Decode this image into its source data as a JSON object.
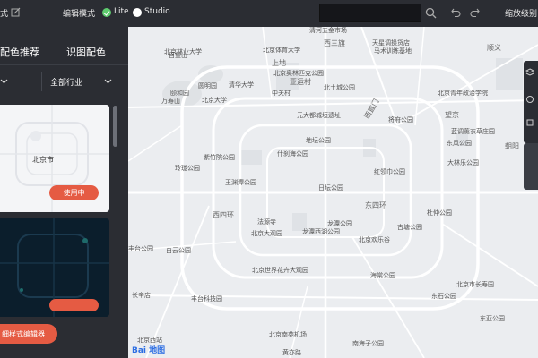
{
  "topbar": {
    "left_text": "式",
    "mode_label": "编辑模式",
    "lite_label": "Lite",
    "studio_label": "Studio",
    "zoom_label": "缩放级别"
  },
  "left_panel": {
    "tab_recommend": "配色推荐",
    "tab_recognize": "识图配色",
    "industry_select": "全部行业",
    "card_light": {
      "city_label": "北京市",
      "use_button": "使用中"
    },
    "editor_button": "细样式编辑器"
  },
  "map": {
    "labels": [
      {
        "text": "清河五金市场"
      },
      {
        "text": "天星调换货店"
      },
      {
        "text": "马术训练基地"
      },
      {
        "text": "西三旗"
      },
      {
        "text": "北京体育大学"
      },
      {
        "text": "北京林业大学"
      },
      {
        "text": "上地"
      },
      {
        "text": "百望山"
      },
      {
        "text": "颐和园"
      },
      {
        "text": "万寿山"
      },
      {
        "text": "清华大学"
      },
      {
        "text": "北京大学"
      },
      {
        "text": "圆明园"
      },
      {
        "text": "北京奥林匹克公园"
      },
      {
        "text": "北土城公园"
      },
      {
        "text": "北京青年政治学院"
      },
      {
        "text": "亚运村"
      },
      {
        "text": "中关村"
      },
      {
        "text": "元大都城垣遗址"
      },
      {
        "text": "将府公园"
      },
      {
        "text": "望京"
      },
      {
        "text": "西直门"
      },
      {
        "text": "地坛公园"
      },
      {
        "text": "蓝调薰衣草庄园"
      },
      {
        "text": "紫竹院公园"
      },
      {
        "text": "什刹海公园"
      },
      {
        "text": "东风公园"
      },
      {
        "text": "大林乐公园"
      },
      {
        "text": "红领巾公园"
      },
      {
        "text": "玲珑公园"
      },
      {
        "text": "玉渊潭公园"
      },
      {
        "text": "日坛公园"
      },
      {
        "text": "东四环"
      },
      {
        "text": "法源寺"
      },
      {
        "text": "龙潭公园"
      },
      {
        "text": "古塘公园"
      },
      {
        "text": "杜仲公园"
      },
      {
        "text": "北京大观园"
      },
      {
        "text": "龙潭西湖公园"
      },
      {
        "text": "北京欢乐谷"
      },
      {
        "text": "西四环"
      },
      {
        "text": "丰台公园"
      },
      {
        "text": "海棠公园"
      },
      {
        "text": "北京世界花卉大观园"
      },
      {
        "text": "东石公园"
      },
      {
        "text": "北京市长寿园"
      },
      {
        "text": "东亚公园"
      },
      {
        "text": "北京南苑机场"
      },
      {
        "text": "南海子公园"
      },
      {
        "text": "黄亦路"
      },
      {
        "text": "北京西站"
      },
      {
        "text": "丰台科技园"
      },
      {
        "text": "白云公园"
      },
      {
        "text": "长辛店"
      },
      {
        "text": "朝阳"
      },
      {
        "text": "顺义"
      }
    ],
    "logo": "Bai 地图"
  }
}
